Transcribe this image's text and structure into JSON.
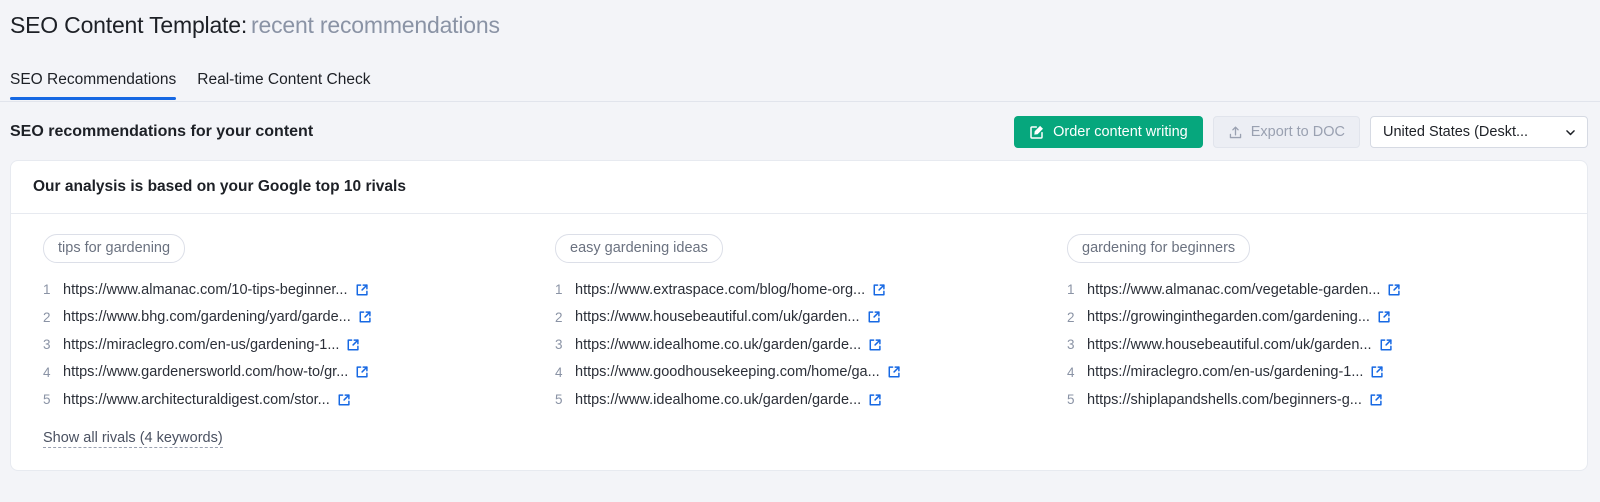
{
  "header": {
    "title_strong": "SEO Content Template:",
    "title_muted": "recent recommendations"
  },
  "tabs": [
    {
      "label": "SEO Recommendations",
      "active": true
    },
    {
      "label": "Real-time Content Check",
      "active": false
    }
  ],
  "toolbar": {
    "title": "SEO recommendations for your content",
    "order_button": "Order content writing",
    "order_icon": "compose-icon",
    "export_button": "Export to DOC",
    "export_icon": "upload-icon",
    "database_select": "United States (Deskt...",
    "select_icon": "chevron-down-icon"
  },
  "card": {
    "heading": "Our analysis is based on your Google top 10 rivals",
    "show_all_label": "Show all rivals (4 keywords)",
    "link_icon": "external-link-icon",
    "columns": [
      {
        "keyword": "tips for gardening",
        "rivals": [
          {
            "rank": "1",
            "url": "https://www.almanac.com/10-tips-beginner..."
          },
          {
            "rank": "2",
            "url": "https://www.bhg.com/gardening/yard/garde..."
          },
          {
            "rank": "3",
            "url": "https://miraclegro.com/en-us/gardening-1..."
          },
          {
            "rank": "4",
            "url": "https://www.gardenersworld.com/how-to/gr..."
          },
          {
            "rank": "5",
            "url": "https://www.architecturaldigest.com/stor..."
          }
        ]
      },
      {
        "keyword": "easy gardening ideas",
        "rivals": [
          {
            "rank": "1",
            "url": "https://www.extraspace.com/blog/home-org..."
          },
          {
            "rank": "2",
            "url": "https://www.housebeautiful.com/uk/garden..."
          },
          {
            "rank": "3",
            "url": "https://www.idealhome.co.uk/garden/garde..."
          },
          {
            "rank": "4",
            "url": "https://www.goodhousekeeping.com/home/ga..."
          },
          {
            "rank": "5",
            "url": "https://www.idealhome.co.uk/garden/garde..."
          }
        ]
      },
      {
        "keyword": "gardening for beginners",
        "rivals": [
          {
            "rank": "1",
            "url": "https://www.almanac.com/vegetable-garden..."
          },
          {
            "rank": "2",
            "url": "https://growinginthegarden.com/gardening..."
          },
          {
            "rank": "3",
            "url": "https://www.housebeautiful.com/uk/garden..."
          },
          {
            "rank": "4",
            "url": "https://miraclegro.com/en-us/gardening-1..."
          },
          {
            "rank": "5",
            "url": "https://shiplapandshells.com/beginners-g..."
          }
        ]
      }
    ]
  },
  "colors": {
    "page_bg": "#f3f4f8",
    "accent_green": "#06a77d",
    "accent_blue": "#1668e3",
    "link_blue": "#1668e3"
  }
}
